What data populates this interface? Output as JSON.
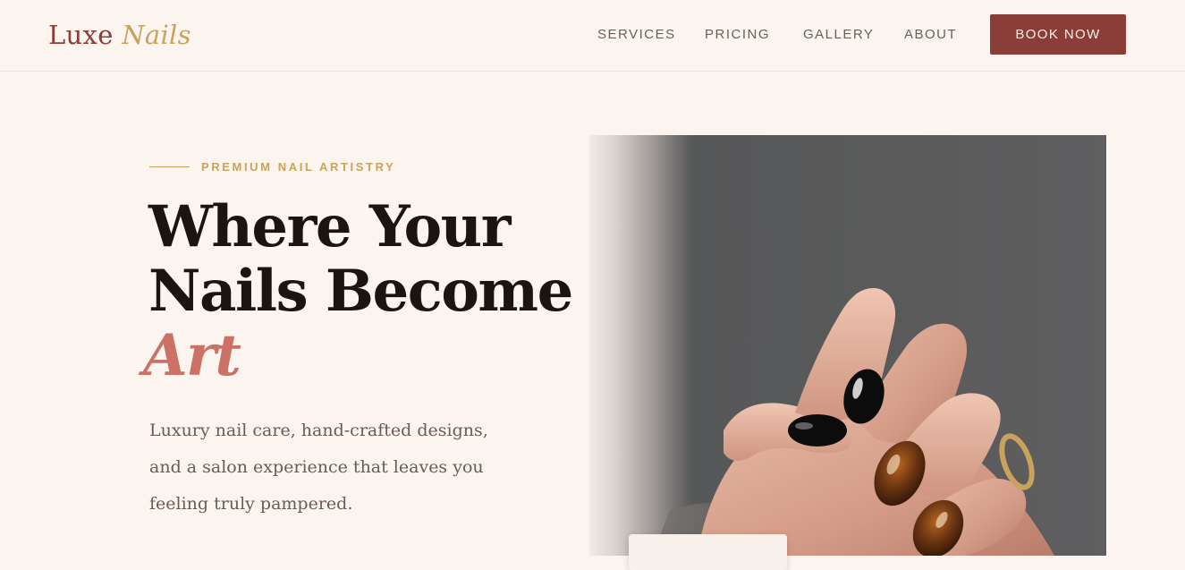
{
  "header": {
    "logo_word1": "Luxe",
    "logo_word2": "Nails",
    "nav": [
      {
        "label": "SERVICES"
      },
      {
        "label": "PRICING"
      },
      {
        "label": "GALLERY"
      },
      {
        "label": "ABOUT"
      }
    ],
    "cta_label": "BOOK NOW"
  },
  "hero": {
    "eyebrow": "PREMIUM NAIL ARTISTRY",
    "headline_line1": "Where Your",
    "headline_line2": "Nails Become",
    "headline_accent": "Art",
    "subtext": "Luxury nail care, hand-crafted designs, and a salon experience that leaves you feeling truly pampered."
  },
  "colors": {
    "background": "#fcf4ee",
    "brand": "#8b3d37",
    "gold": "#c9a25b",
    "accent": "#cc7165",
    "heading": "#1b140f"
  }
}
